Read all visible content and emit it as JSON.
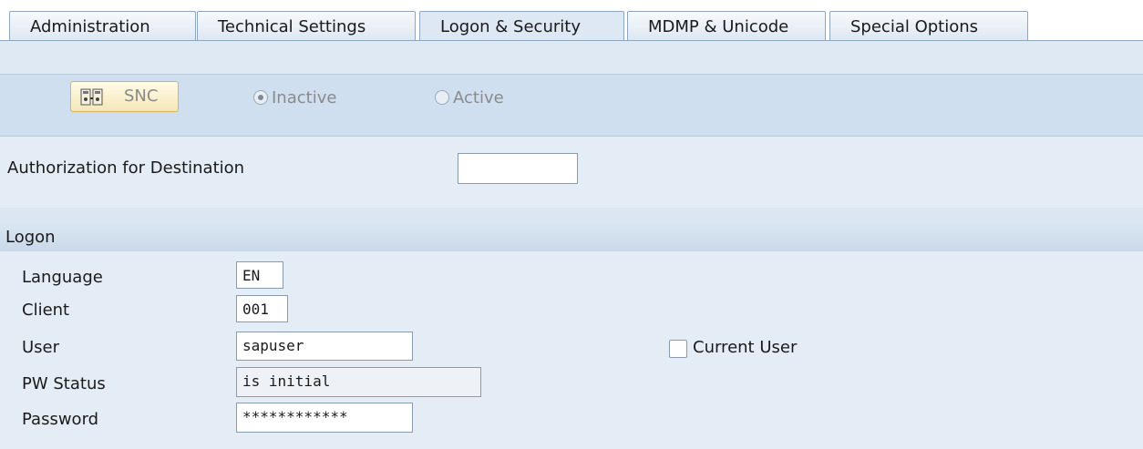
{
  "tabs": [
    {
      "label": "Administration"
    },
    {
      "label": "Technical Settings"
    },
    {
      "label": "Logon & Security"
    },
    {
      "label": "MDMP & Unicode"
    },
    {
      "label": "Special Options"
    }
  ],
  "active_tab": "Logon & Security",
  "snc": {
    "button_label": "SNC",
    "icon": "snc-icon",
    "radio_inactive_label": "Inactive",
    "radio_active_label": "Active",
    "selected": "Inactive"
  },
  "authorization": {
    "label": "Authorization for Destination",
    "value": ""
  },
  "logon": {
    "section_title": "Logon",
    "language_label": "Language",
    "language_value": "EN",
    "client_label": "Client",
    "client_value": "001",
    "user_label": "User",
    "user_value": "sapuser",
    "current_user_label": "Current User",
    "current_user_checked": false,
    "pw_status_label": "PW Status",
    "pw_status_value": "is initial",
    "password_label": "Password",
    "password_value": "************"
  }
}
